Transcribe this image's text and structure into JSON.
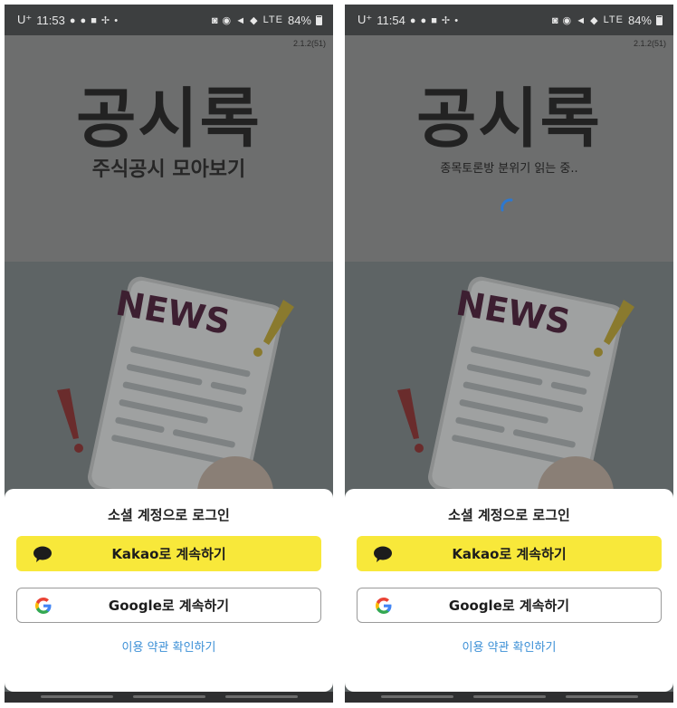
{
  "screens": [
    {
      "status": {
        "carrier": "U⁺",
        "time": "11:53",
        "battery": "84%",
        "network": "LTE"
      },
      "version": "2.1.2(51)",
      "logo": "공시록",
      "subtitle": "주식공시 모아보기",
      "news_word": "NEWS",
      "sheet": {
        "title": "소셜 계정으로 로그인",
        "kakao_label": "Kakao로 계속하기",
        "google_label": "Google로 계속하기",
        "terms_label": "이용 약관 확인하기"
      }
    },
    {
      "status": {
        "carrier": "U⁺",
        "time": "11:54",
        "battery": "84%",
        "network": "LTE"
      },
      "version": "2.1.2(51)",
      "logo": "공시록",
      "subtitle": "종목토론방 분위기 읽는 중..",
      "news_word": "NEWS",
      "sheet": {
        "title": "소셜 계정으로 로그인",
        "kakao_label": "Kakao로 계속하기",
        "google_label": "Google로 계속하기",
        "terms_label": "이용 약관 확인하기"
      }
    }
  ],
  "colors": {
    "kakao": "#f8e83a",
    "terms_link": "#3b8fd6",
    "spinner": "#2d78d0"
  }
}
